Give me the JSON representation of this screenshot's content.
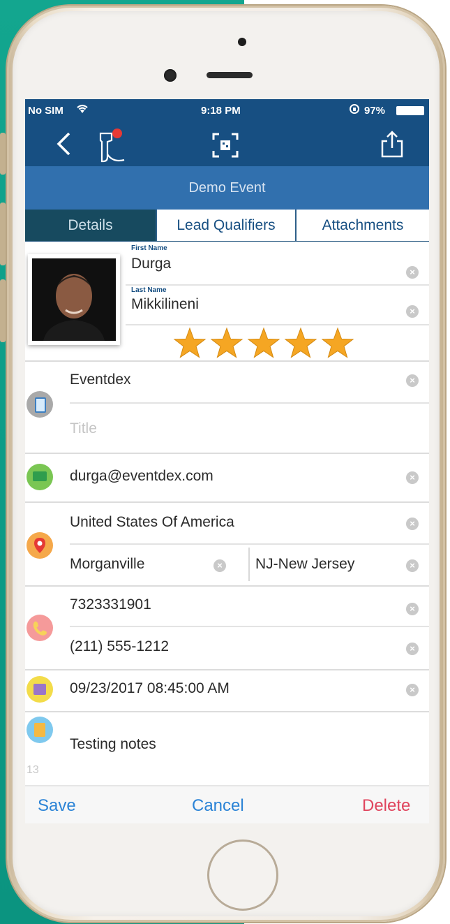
{
  "status_bar": {
    "carrier": "No SIM",
    "time": "9:18 PM",
    "battery": "97%"
  },
  "nav": {
    "back_icon": "chevron-left-icon",
    "scanner_icon": "barcode-scanner-icon",
    "qr_icon": "qr-scan-icon",
    "share_icon": "share-icon"
  },
  "title": "Demo Event",
  "tabs": [
    {
      "label": "Details",
      "active": true
    },
    {
      "label": "Lead Qualifiers",
      "active": false
    },
    {
      "label": "Attachments",
      "active": false
    }
  ],
  "contact": {
    "first_name_label": "First Name",
    "first_name": "Durga",
    "last_name_label": "Last Name",
    "last_name": "Mikkilineni",
    "rating": 5,
    "rating_max": 5,
    "company": "Eventdex",
    "title_placeholder": "Title",
    "email": "durga@eventdex.com",
    "country": "United States Of America",
    "city": "Morganville",
    "state": "NJ-New Jersey",
    "phone1": "7323331901",
    "phone2": "(211) 555-1212",
    "datetime": "09/23/2017 08:45:00 AM",
    "notes": "Testing notes",
    "notes_count": "13"
  },
  "footer": {
    "save": "Save",
    "cancel": "Cancel",
    "delete": "Delete"
  },
  "colors": {
    "nav_blue": "#174f82",
    "title_blue": "#3170ae",
    "active_tab": "#174a5f",
    "link_blue": "#2b83d6",
    "delete_red": "#e0445d",
    "star": "#f5a623"
  }
}
